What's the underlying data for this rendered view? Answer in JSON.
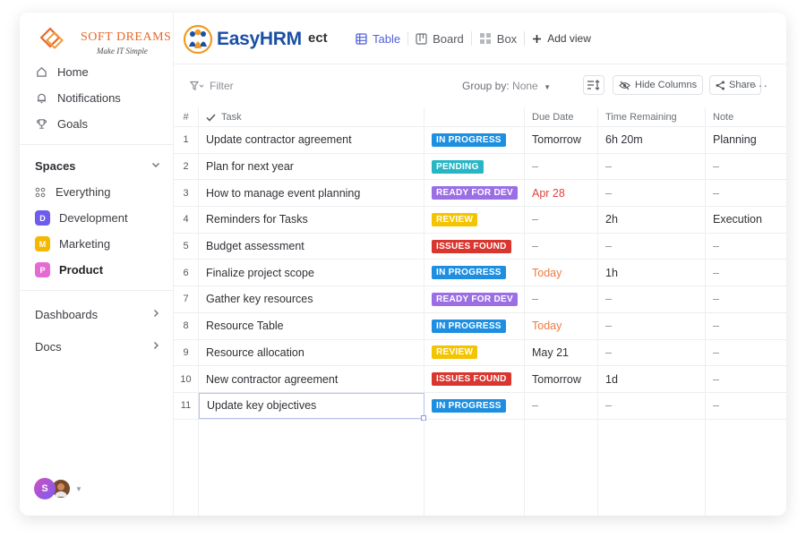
{
  "brand": {
    "name": "SOFT DREAMS",
    "tagline": "Make IT Simple"
  },
  "logo": {
    "text_easy": "Easy",
    "text_hrm": "HRM"
  },
  "header": {
    "title_fragment": "ect"
  },
  "views": [
    {
      "label": "Table",
      "icon": "table-icon",
      "active": true
    },
    {
      "label": "Board",
      "icon": "board-icon",
      "active": false
    },
    {
      "label": "Box",
      "icon": "box-icon",
      "active": false
    }
  ],
  "add_view_label": "Add view",
  "sidebar": {
    "nav": [
      {
        "label": "Home",
        "icon": "home-icon"
      },
      {
        "label": "Notifications",
        "icon": "bell-icon"
      },
      {
        "label": "Goals",
        "icon": "trophy-icon"
      }
    ],
    "spaces_label": "Spaces",
    "everything_label": "Everything",
    "spaces": [
      {
        "label": "Development",
        "letter": "D",
        "color": "#6e5cf0"
      },
      {
        "label": "Marketing",
        "letter": "M",
        "color": "#f5b800"
      },
      {
        "label": "Product",
        "letter": "P",
        "color": "#e56bd2",
        "active": true
      }
    ],
    "dashboards_label": "Dashboards",
    "docs_label": "Docs",
    "avatar_letter": "S"
  },
  "toolbar": {
    "filter_label": "Filter",
    "groupby_label": "Group by:",
    "groupby_value": "None",
    "hide_columns_label": "Hide Columns",
    "share_label": "Share",
    "more_label": "···"
  },
  "table": {
    "columns": {
      "num": "#",
      "task": "Task",
      "status": "",
      "due": "Due Date",
      "remaining": "Time Remaining",
      "note": "Note"
    },
    "status_colors": {
      "IN PROGRESS": "#1e8fe0",
      "PENDING": "#27b6c6",
      "READY FOR DEV": "#9b6ee6",
      "REVIEW": "#f5c400",
      "ISSUES FOUND": "#d8362f"
    },
    "rows": [
      {
        "num": "1",
        "task": "Update contractor agreement",
        "status": "IN PROGRESS",
        "due": "Tomorrow",
        "due_style": "",
        "remaining": "6h 20m",
        "note": "Planning"
      },
      {
        "num": "2",
        "task": "Plan for next year",
        "status": "PENDING",
        "due": "–",
        "due_style": "muted",
        "remaining": "–",
        "note": "–"
      },
      {
        "num": "3",
        "task": "How to manage event planning",
        "status": "READY FOR DEV",
        "due": "Apr 28",
        "due_style": "red",
        "remaining": "–",
        "note": "–"
      },
      {
        "num": "4",
        "task": "Reminders for Tasks",
        "status": "REVIEW",
        "due": "–",
        "due_style": "muted",
        "remaining": "2h",
        "note": "Execution"
      },
      {
        "num": "5",
        "task": "Budget assessment",
        "status": "ISSUES FOUND",
        "due": "–",
        "due_style": "muted",
        "remaining": "–",
        "note": "–"
      },
      {
        "num": "6",
        "task": "Finalize project scope",
        "status": "IN PROGRESS",
        "due": "Today",
        "due_style": "orange",
        "remaining": "1h",
        "note": "–"
      },
      {
        "num": "7",
        "task": "Gather key resources",
        "status": "READY FOR DEV",
        "due": "–",
        "due_style": "muted",
        "remaining": "–",
        "note": "–"
      },
      {
        "num": "8",
        "task": "Resource Table",
        "status": "IN PROGRESS",
        "due": "Today",
        "due_style": "orange",
        "remaining": "–",
        "note": "–"
      },
      {
        "num": "9",
        "task": "Resource allocation",
        "status": "REVIEW",
        "due": "May 21",
        "due_style": "",
        "remaining": "–",
        "note": "–"
      },
      {
        "num": "10",
        "task": "New contractor agreement",
        "status": "ISSUES FOUND",
        "due": "Tomorrow",
        "due_style": "",
        "remaining": "1d",
        "note": "–"
      },
      {
        "num": "11",
        "task": "Update key objectives",
        "status": "IN PROGRESS",
        "due": "–",
        "due_style": "muted",
        "remaining": "–",
        "note": "–",
        "selected": true
      }
    ]
  }
}
